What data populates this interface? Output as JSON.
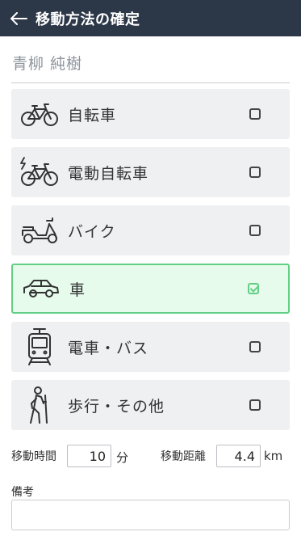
{
  "header": {
    "title": "移動方法の確定",
    "back_icon": "arrow-left-icon"
  },
  "user": {
    "name": "青柳 純樹"
  },
  "options": [
    {
      "label": "自転車",
      "icon": "bicycle-icon",
      "selected": false
    },
    {
      "label": "電動自転車",
      "icon": "electric-bicycle-icon",
      "selected": false
    },
    {
      "label": "バイク",
      "icon": "scooter-icon",
      "selected": false
    },
    {
      "label": "車",
      "icon": "car-icon",
      "selected": true
    },
    {
      "label": "電車・バス",
      "icon": "train-icon",
      "selected": false
    },
    {
      "label": "歩行・その他",
      "icon": "walker-icon",
      "selected": false
    }
  ],
  "travel": {
    "time_label": "移動時間",
    "time_value": "10",
    "time_unit": "分",
    "distance_label": "移動距離",
    "distance_value": "4.4",
    "distance_unit": "km"
  },
  "memo": {
    "label": "備考",
    "value": ""
  },
  "colors": {
    "header_bg": "#2c3747",
    "selected_border": "#62cf84",
    "selected_bg": "#e6fbec",
    "option_bg": "#eef0f1"
  }
}
